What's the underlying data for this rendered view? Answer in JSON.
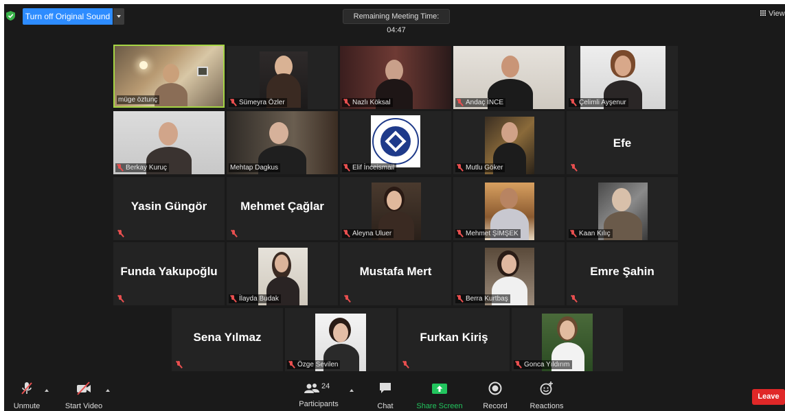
{
  "top_bar": {
    "original_sound_label": "Turn off Original Sound",
    "remaining_time": "Remaining Meeting Time: 04:47",
    "view_label": "View"
  },
  "participants": [
    {
      "name": "müge öztunç",
      "muted": false,
      "video": true,
      "active_speaker": true
    },
    {
      "name": "Sümeyra Özler",
      "muted": true,
      "video": true
    },
    {
      "name": "Nazlı Köksal",
      "muted": true,
      "video": true
    },
    {
      "name": "Andaç İNCE",
      "muted": true,
      "video": true
    },
    {
      "name": "Çelimli Ayşenur",
      "muted": true,
      "video": true
    },
    {
      "name": "Berkay Kuruç",
      "muted": true,
      "video": true
    },
    {
      "name": "Mehtap Dagkus",
      "muted": false,
      "video": true
    },
    {
      "name": "Elif İnceismail",
      "muted": true,
      "video": true
    },
    {
      "name": "Mutlu Göker",
      "muted": true,
      "video": true
    },
    {
      "name": "Efe",
      "muted": true,
      "video": false
    },
    {
      "name": "Yasin Güngör",
      "muted": true,
      "video": false
    },
    {
      "name": "Mehmet Çağlar",
      "muted": true,
      "video": false
    },
    {
      "name": "Aleyna Uluer",
      "muted": true,
      "video": true
    },
    {
      "name": "Mehmet ŞİMŞEK",
      "muted": true,
      "video": true
    },
    {
      "name": "Kaan Kılıç",
      "muted": true,
      "video": true
    },
    {
      "name": "Funda Yakupoğlu",
      "muted": true,
      "video": false
    },
    {
      "name": "İlayda Budak",
      "muted": true,
      "video": true
    },
    {
      "name": "Mustafa Mert",
      "muted": true,
      "video": false
    },
    {
      "name": "Berra Kurtbaş",
      "muted": true,
      "video": true
    },
    {
      "name": "Emre Şahin",
      "muted": true,
      "video": false
    },
    {
      "name": "Sena Yılmaz",
      "muted": true,
      "video": false
    },
    {
      "name": "Özge Sevilen",
      "muted": true,
      "video": true
    },
    {
      "name": "Furkan Kiriş",
      "muted": true,
      "video": false
    },
    {
      "name": "Gonca Yıldırım",
      "muted": true,
      "video": true
    }
  ],
  "toolbar": {
    "unmute_label": "Unmute",
    "start_video_label": "Start Video",
    "participants_label": "Participants",
    "participants_count": "24",
    "chat_label": "Chat",
    "share_screen_label": "Share Screen",
    "record_label": "Record",
    "reactions_label": "Reactions",
    "leave_label": "Leave"
  },
  "colors": {
    "background": "#1a1a1a",
    "tile": "#232323",
    "active_speaker_border": "#a5d544",
    "original_sound_button": "#2d8cff",
    "share_screen": "#22c55e",
    "leave": "#e02828",
    "muted_icon": "#e84f4f"
  }
}
